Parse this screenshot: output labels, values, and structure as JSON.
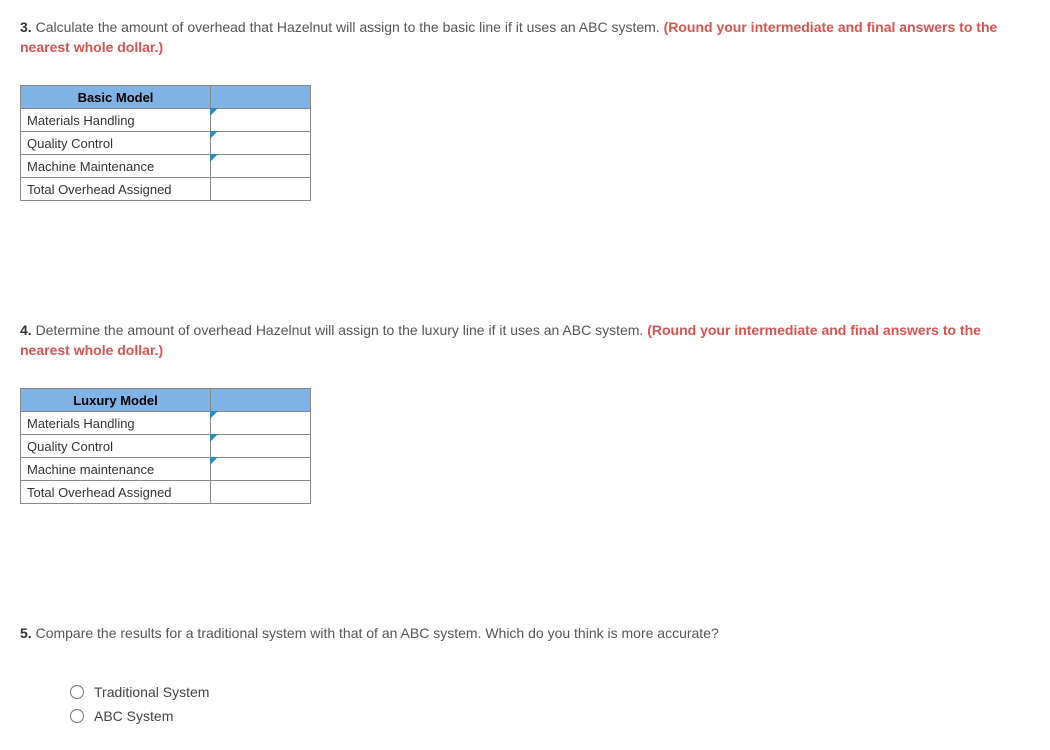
{
  "q3": {
    "number": "3.",
    "text": " Calculate the amount of overhead that Hazelnut will assign to the basic line if it uses an ABC system. ",
    "hint": "(Round your intermediate and final answers to the nearest whole dollar.)",
    "table_header": "Basic Model",
    "rows": [
      "Materials Handling",
      "Quality Control",
      "Machine Maintenance",
      "Total Overhead Assigned"
    ]
  },
  "q4": {
    "number": "4.",
    "text": " Determine the amount of overhead Hazelnut will assign to the luxury line if it uses an ABC system. ",
    "hint": "(Round your intermediate and final answers to the nearest whole dollar.)",
    "table_header": "Luxury  Model",
    "rows": [
      "Materials Handling",
      "Quality Control",
      "Machine maintenance",
      "Total Overhead Assigned"
    ]
  },
  "q5": {
    "number": "5.",
    "text": " Compare the results for a traditional system with that of an ABC system. Which do you think is more accurate?",
    "options": [
      "Traditional System",
      "ABC System"
    ]
  }
}
